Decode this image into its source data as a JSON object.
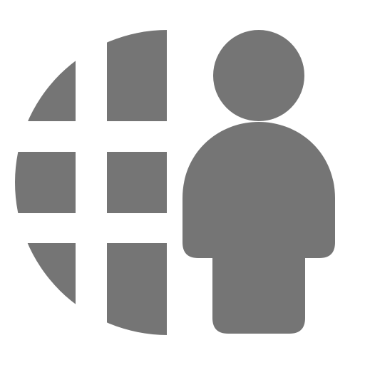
{
  "icon": {
    "name": "globe-user-icon",
    "fill_color": "#757575",
    "background_color": "#ffffff",
    "parts": [
      "globe-grid-icon",
      "person-icon"
    ]
  }
}
